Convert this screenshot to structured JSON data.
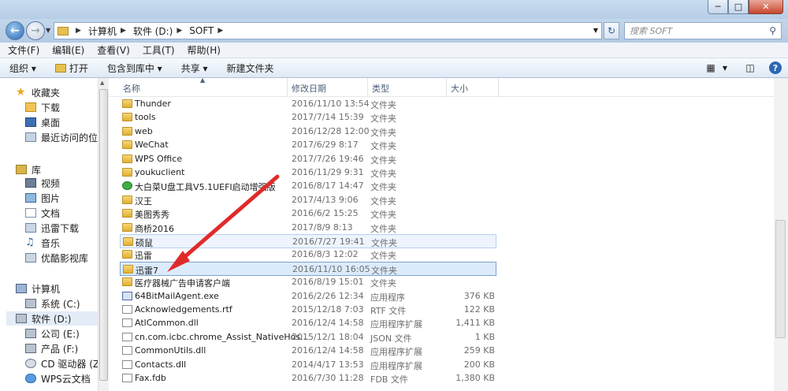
{
  "title_watermark": "",
  "window_buttons": {
    "min": "─",
    "max": "□",
    "close": "✕"
  },
  "address": {
    "crumbs": [
      "计算机",
      "软件 (D:)",
      "SOFT"
    ]
  },
  "search": {
    "placeholder": "搜索 SOFT"
  },
  "menus": [
    "文件(F)",
    "编辑(E)",
    "查看(V)",
    "工具(T)",
    "帮助(H)"
  ],
  "toolbar": {
    "organize": "组织 ▾",
    "open": "打开",
    "include": "包含到库中 ▾",
    "share": "共享 ▾",
    "new_folder": "新建文件夹"
  },
  "sidebar": {
    "favorites": {
      "title": "收藏夹",
      "items": [
        "下载",
        "桌面",
        "最近访问的位置"
      ]
    },
    "libraries": {
      "title": "库",
      "items": [
        "视频",
        "图片",
        "文档",
        "迅雷下载",
        "音乐",
        "优酷影视库"
      ]
    },
    "computer": {
      "title": "计算机",
      "items": [
        "系统 (C:)",
        "软件 (D:)",
        "公司 (E:)",
        "产品 (F:)",
        "CD 驱动器 (Z:)",
        "WPS云文档"
      ]
    }
  },
  "columns": {
    "name": "名称",
    "date": "修改日期",
    "type": "类型",
    "size": "大小"
  },
  "files": [
    {
      "name": "Thunder",
      "date": "2016/11/10 13:54",
      "type": "文件夹",
      "size": "",
      "icon": "folder"
    },
    {
      "name": "tools",
      "date": "2017/7/14 15:39",
      "type": "文件夹",
      "size": "",
      "icon": "folder"
    },
    {
      "name": "web",
      "date": "2016/12/28 12:00",
      "type": "文件夹",
      "size": "",
      "icon": "folder"
    },
    {
      "name": "WeChat",
      "date": "2017/6/29 8:17",
      "type": "文件夹",
      "size": "",
      "icon": "folder"
    },
    {
      "name": "WPS Office",
      "date": "2017/7/26 19:46",
      "type": "文件夹",
      "size": "",
      "icon": "folder"
    },
    {
      "name": "youkuclient",
      "date": "2016/11/29 9:31",
      "type": "文件夹",
      "size": "",
      "icon": "folder"
    },
    {
      "name": "大白菜U盘工具V5.1UEFI启动增强版",
      "date": "2016/8/17 14:47",
      "type": "文件夹",
      "size": "",
      "icon": "app"
    },
    {
      "name": "汉王",
      "date": "2017/4/13 9:06",
      "type": "文件夹",
      "size": "",
      "icon": "folder"
    },
    {
      "name": "美图秀秀",
      "date": "2016/6/2 15:25",
      "type": "文件夹",
      "size": "",
      "icon": "folder"
    },
    {
      "name": "商桥2016",
      "date": "2017/8/9 8:13",
      "type": "文件夹",
      "size": "",
      "icon": "folder"
    },
    {
      "name": "硕鼠",
      "date": "2016/7/27 19:41",
      "type": "文件夹",
      "size": "",
      "icon": "folder"
    },
    {
      "name": "迅雷",
      "date": "2016/8/3 12:02",
      "type": "文件夹",
      "size": "",
      "icon": "folder"
    },
    {
      "name": "迅雷7",
      "date": "2016/11/10 16:05",
      "type": "文件夹",
      "size": "",
      "icon": "folder"
    },
    {
      "name": "医疗器械广告申请客户端",
      "date": "2016/8/19 15:01",
      "type": "文件夹",
      "size": "",
      "icon": "folder"
    },
    {
      "name": "64BitMailAgent.exe",
      "date": "2016/2/26 12:34",
      "type": "应用程序",
      "size": "376 KB",
      "icon": "exe"
    },
    {
      "name": "Acknowledgements.rtf",
      "date": "2015/12/18 7:03",
      "type": "RTF 文件",
      "size": "122 KB",
      "icon": "file"
    },
    {
      "name": "AtlCommon.dll",
      "date": "2016/12/4 14:58",
      "type": "应用程序扩展",
      "size": "1,411 KB",
      "icon": "file"
    },
    {
      "name": "cn.com.icbc.chrome_Assist_NativeHos...",
      "date": "2015/12/1 18:04",
      "type": "JSON 文件",
      "size": "1 KB",
      "icon": "file"
    },
    {
      "name": "CommonUtils.dll",
      "date": "2016/12/4 14:58",
      "type": "应用程序扩展",
      "size": "259 KB",
      "icon": "file"
    },
    {
      "name": "Contacts.dll",
      "date": "2014/4/17 13:53",
      "type": "应用程序扩展",
      "size": "200 KB",
      "icon": "file"
    },
    {
      "name": "Fax.fdb",
      "date": "2016/7/30 11:28",
      "type": "FDB 文件",
      "size": "1,380 KB",
      "icon": "file"
    }
  ]
}
